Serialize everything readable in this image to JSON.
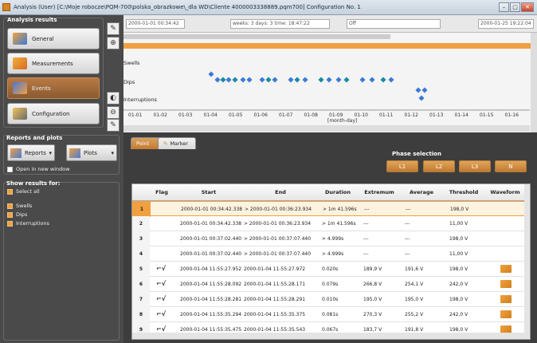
{
  "window": {
    "title": "Analysis (User) [C:\\Moje robocze\\PQM-700\\polska_obrazkowe\\_dla WD\\Cliente 4000003338889.pqm700] Configuration No. 1",
    "minimize": "–",
    "maximize": "□",
    "close": "✕"
  },
  "sidebar": {
    "analysis_title": "Analysis results",
    "nav": [
      {
        "label": "General",
        "icon": "general-icon"
      },
      {
        "label": "Measurements",
        "icon": "measurements-icon"
      },
      {
        "label": "Events",
        "icon": "events-icon",
        "active": true
      },
      {
        "label": "Configuration",
        "icon": "configuration-icon"
      }
    ],
    "reports_title": "Reports and plots",
    "reports_label": "Reports",
    "plots_label": "Plots",
    "open_new_window": "Open in new window",
    "show_results_title": "Show results for:",
    "select_all": "Select all",
    "filters": [
      "Swells",
      "Dips",
      "Interruptions"
    ]
  },
  "chart": {
    "start_time": "2000-01-01 00:34:42",
    "weeks_text": "weeks: 3 days: 3 time: 18:47:22",
    "off_option": "Off",
    "end_time": "2000-01-25 19:22:04",
    "lanes": [
      "Swells",
      "Dips",
      "Interruptions"
    ],
    "x_ticks": [
      "01-01",
      "01-02",
      "01-03",
      "01-04",
      "01-05",
      "01-06",
      "01-07",
      "01-08",
      "01-09",
      "01-10",
      "01-11",
      "01-12",
      "01-13",
      "01-14",
      "01-15",
      "01-16"
    ],
    "x_label": "[month-day]"
  },
  "tabs": {
    "point": "Point",
    "marker": "Marker"
  },
  "phase": {
    "title": "Phase selection",
    "buttons": [
      "L1",
      "L2",
      "L3",
      "N"
    ]
  },
  "table": {
    "headers": [
      "",
      "Flag",
      "Start",
      "End",
      "Duration",
      "Extremum",
      "Average",
      "Threshold",
      "Waveform"
    ],
    "rows": [
      {
        "n": "1",
        "start": "2000-01-01 00:34:42.338",
        "end": "> 2000-01-01 00:36:23.934",
        "duration": "> 1m 41.596s",
        "extremum": "---",
        "average": "---",
        "threshold": "198,0 V",
        "flag": false,
        "wave": false
      },
      {
        "n": "2",
        "start": "2000-01-01 00:34:42.338",
        "end": "> 2000-01-01 00:36:23.934",
        "duration": "> 1m 41.596s",
        "extremum": "---",
        "average": "---",
        "threshold": "11,00 V",
        "flag": false,
        "wave": false
      },
      {
        "n": "3",
        "start": "2000-01-01 00:37:02.440",
        "end": "> 2000-01-01 00:37:07.440",
        "duration": "> 4.999s",
        "extremum": "---",
        "average": "---",
        "threshold": "198,0 V",
        "flag": false,
        "wave": false
      },
      {
        "n": "4",
        "start": "2000-01-01 00:37:02.440",
        "end": "> 2000-01-01 00:37:07.440",
        "duration": "> 4.999s",
        "extremum": "---",
        "average": "---",
        "threshold": "11,00 V",
        "flag": false,
        "wave": false
      },
      {
        "n": "5",
        "start": "2000-01-04 11:55:27.952",
        "end": "2000-01-04 11:55:27.972",
        "duration": "0.020s",
        "extremum": "189,9 V",
        "average": "191,6 V",
        "threshold": "198,0 V",
        "flag": true,
        "wave": true
      },
      {
        "n": "6",
        "start": "2000-01-04 11:55:28.092",
        "end": "2000-01-04 11:55:28.171",
        "duration": "0.079s",
        "extremum": "266,8 V",
        "average": "254,1 V",
        "threshold": "242,0 V",
        "flag": true,
        "wave": true
      },
      {
        "n": "7",
        "start": "2000-01-04 11:55:28.281",
        "end": "2000-01-04 11:55:28.291",
        "duration": "0.010s",
        "extremum": "195,0 V",
        "average": "195,0 V",
        "threshold": "198,0 V",
        "flag": true,
        "wave": true
      },
      {
        "n": "8",
        "start": "2000-01-04 11:55:35.294",
        "end": "2000-01-04 11:55:35.375",
        "duration": "0.081s",
        "extremum": "270,3 V",
        "average": "255,2 V",
        "threshold": "242,0 V",
        "flag": true,
        "wave": true
      },
      {
        "n": "9",
        "start": "2000-01-04 11:55:35.475",
        "end": "2000-01-04 11:55:35.543",
        "duration": "0.067s",
        "extremum": "183,7 V",
        "average": "191,8 V",
        "threshold": "198,0 V",
        "flag": true,
        "wave": true
      }
    ]
  }
}
